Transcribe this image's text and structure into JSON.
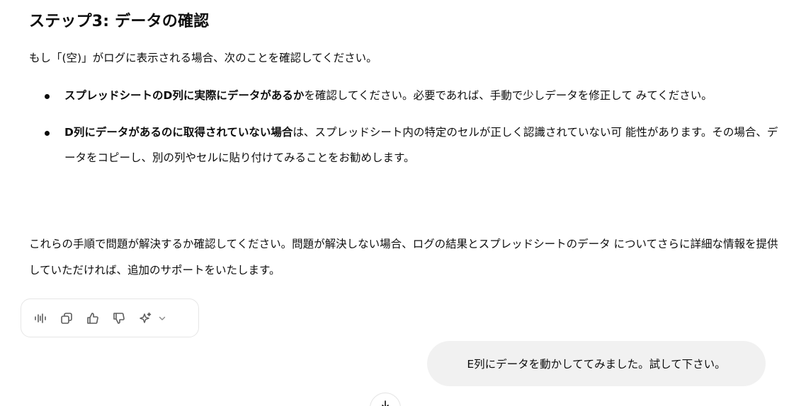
{
  "message": {
    "heading": "ステップ3: データの確認",
    "intro": "もし「(空)」がログに表示される場合、次のことを確認してください。",
    "bullets": [
      {
        "bold": "スプレッドシートのD列に実際にデータがあるか",
        "text": "を確認してください。必要であれば、手動で少しデータを修正して みてください。"
      },
      {
        "bold": "D列にデータがあるのに取得されていない場合",
        "text": "は、スプレッドシート内の特定のセルが正しく認識されていない可 能性があります。その場合、データをコピーし、別の列やセルに貼り付けてみることをお勧めします。"
      }
    ],
    "closing": "これらの手順で問題が解決するか確認してください。問題が解決しない場合、ログの結果とスプレッドシートのデータ についてさらに詳細な情報を提供していただければ、追加のサポートをいたします。"
  },
  "actions": {
    "icons": [
      "read-aloud-icon",
      "copy-icon",
      "thumbs-up-icon",
      "thumbs-down-icon",
      "sparkle-icon",
      "chevron-down-icon"
    ]
  },
  "user_message": {
    "text": "E列にデータを動かしててみました。試して下さい。"
  },
  "scroll": {
    "icon": "arrow-down-icon"
  }
}
